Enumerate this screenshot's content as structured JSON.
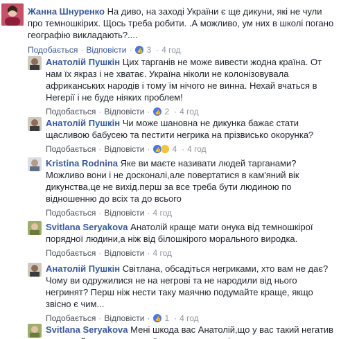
{
  "comments": [
    {
      "author": "Жанна Шнуренко",
      "text": "На диво, на заході України є ще дикуни, які не чули про темношкірих. Щось треба робити. .А можливо, ум них в школі погано географію викладають?....",
      "like": "Подобається",
      "reply": "Відповісти",
      "reactions": "3",
      "time": "4 год"
    },
    {
      "author": "Анатолій Пушкін",
      "text": "Цих тарганів не може вивести жодна країна. От нам їх якраз і не хватає. Україна ніколи не колонізовувала африканських народів і тому їм нічого не винна. Нехай вчаться в Негерії і не буде ніяких проблем!",
      "like": "Подобається",
      "reply": "Відповісти",
      "reactions": "2",
      "time": "4 год"
    },
    {
      "author": "Анатолій Пушкін",
      "text": "Чи може шановна не дикунка бажає стати щасливою бабусею та пестити негрика на прізвисько окорунка?",
      "like": "Подобається",
      "reply": "Відповісти",
      "reactions": "4",
      "time": "4 год"
    },
    {
      "author": "Kristina Rodnina",
      "text": "Яке ви маєте називати людей тарганами? Можливо вони і не досконалі,але повертатися в кам'яний вік дикунства,це не вихід.перш за все треба бути людиною по відношенню до всіх та до всього",
      "like": "Подобається",
      "reply": "Відповісти",
      "reactions": "",
      "time": "4 год"
    },
    {
      "author": "Svitlana Seryakova",
      "text": "Анатолій краще мати онука від темношкірої порядної людини,а ніж від білошкірого морального виродка.",
      "like": "Подобається",
      "reply": "Відповісти",
      "reactions": "",
      "time": "4 год"
    },
    {
      "author": "Анатолій Пушкін",
      "text": "Світлана, обсадіться негриками, хто вам не дає? Чому ви одружилися не на негрові та не народили від нього негринят? Перш ніж нести таку маячню подумайте краще, якщо звісно є чим...",
      "like": "Подобається",
      "reply": "Відповісти",
      "reactions": "1",
      "time": "4 год"
    },
    {
      "author": "Svitlana Seryakova",
      "text": "Мені шкода вас Анатолій,що у вас такий негатив до людей,напевно з вашої дитини психологія",
      "like": "",
      "reply": "",
      "reactions": "",
      "time": ""
    }
  ]
}
